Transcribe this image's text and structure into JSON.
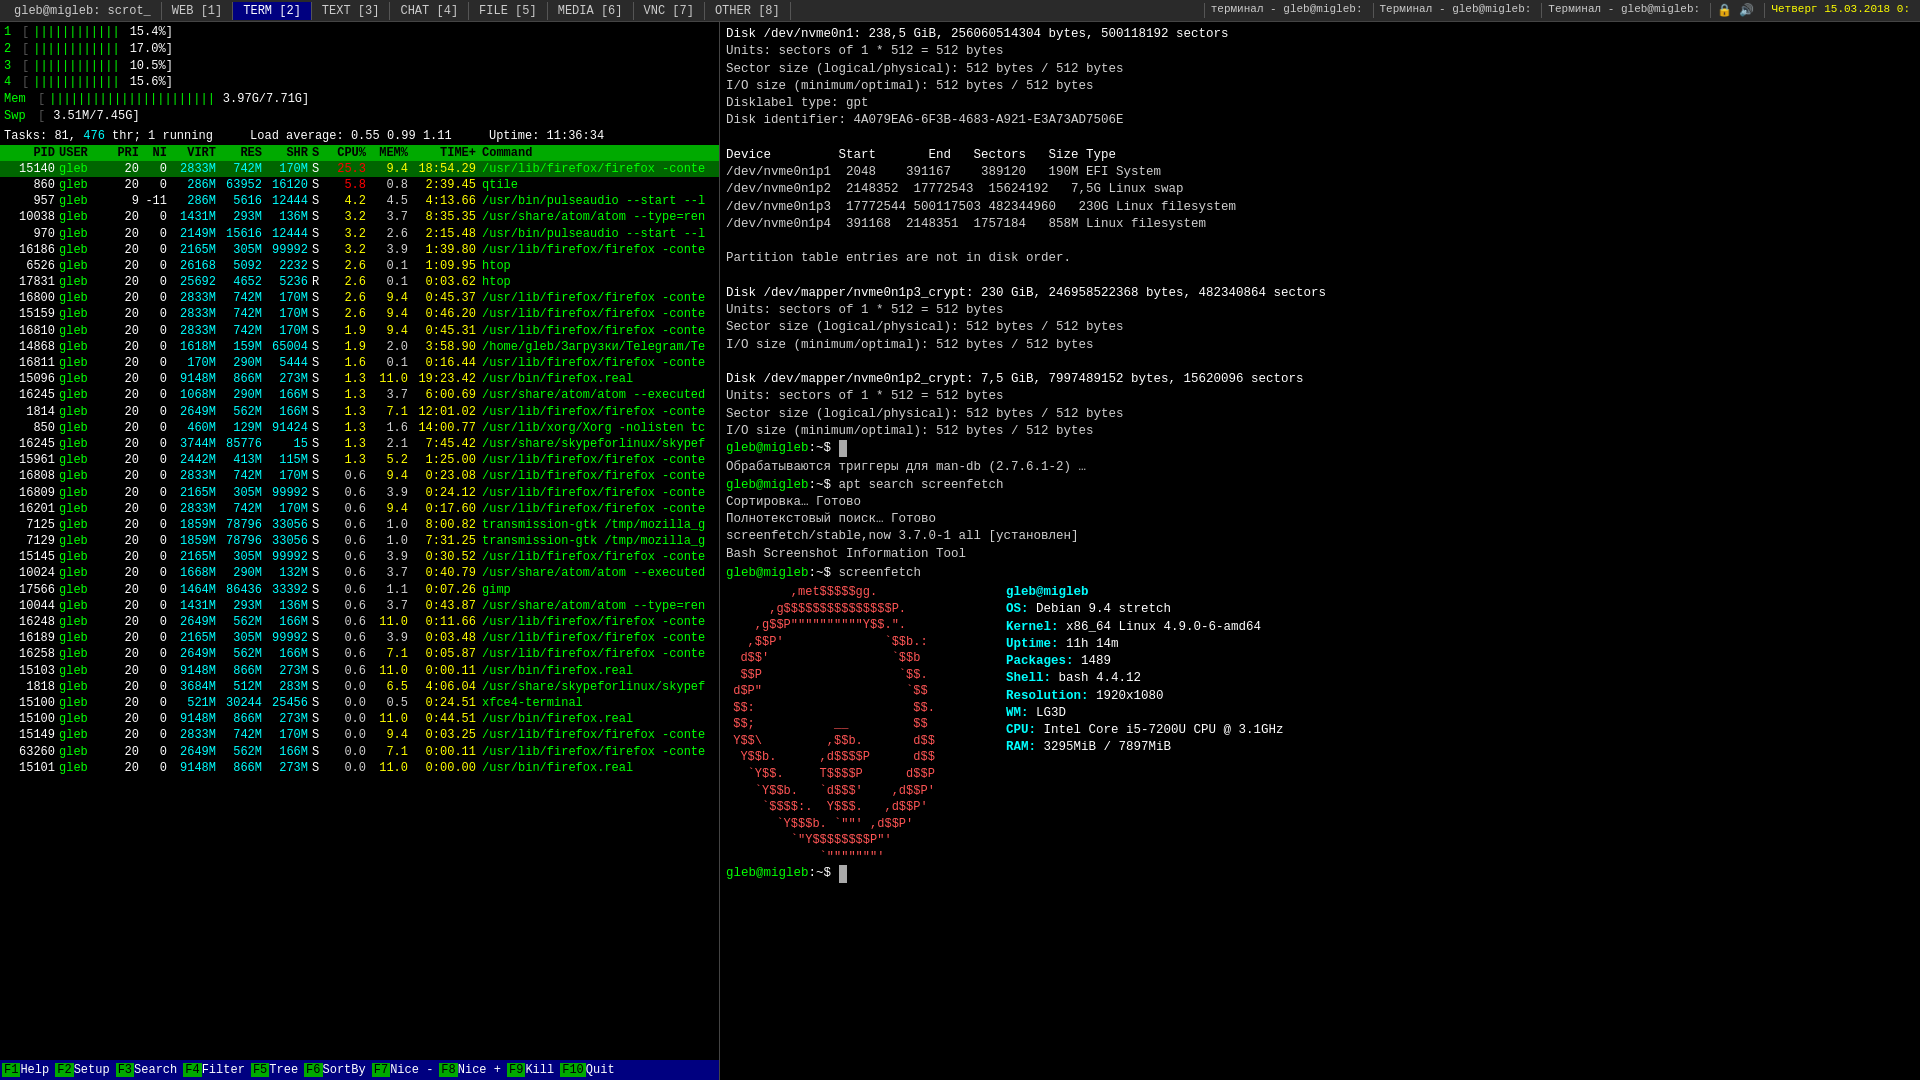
{
  "topbar": {
    "tabs": [
      {
        "label": "gleb@migleb: scrot_",
        "active": false,
        "type": "tab"
      },
      {
        "label": "WEB [1]",
        "active": false,
        "type": "tab"
      },
      {
        "label": "TERM [2]",
        "active": true,
        "type": "tab"
      },
      {
        "label": "TEXT [3]",
        "active": false,
        "type": "tab"
      },
      {
        "label": "CHAT [4]",
        "active": false,
        "type": "tab"
      },
      {
        "label": "FILE [5]",
        "active": false,
        "type": "tab"
      },
      {
        "label": "MEDIA [6]",
        "active": false,
        "type": "tab"
      },
      {
        "label": "VNC [7]",
        "active": false,
        "type": "tab"
      },
      {
        "label": "OTHER [8]",
        "active": false,
        "type": "tab"
      }
    ],
    "right_tabs": [
      {
        "label": "терминал - gleb@migleb:",
        "active": false
      },
      {
        "label": "Терминал - gleb@migleb:",
        "active": false
      },
      {
        "label": "Терминал - gleb@migleb:",
        "active": false
      }
    ],
    "datetime": "Четверг 15.03.2018 0:",
    "icon1": "🔒",
    "icon2": "🔊"
  },
  "htop": {
    "cpus": [
      {
        "num": "1",
        "bars": "||||||||||||",
        "pct": "15.4"
      },
      {
        "num": "2",
        "bars": "||||||||||||",
        "pct": "17.0"
      },
      {
        "num": "3",
        "bars": "||||||||||||",
        "pct": "10.5"
      },
      {
        "num": "4",
        "bars": "||||||||||||",
        "pct": "15.6"
      }
    ],
    "mem": {
      "bars": "||||||||||||||||||||||||",
      "used": "3.97G",
      "total": "7.71G"
    },
    "swp": {
      "bars": "",
      "used": "3.51M",
      "total": "7.45G"
    },
    "tasks_label": "Tasks:",
    "tasks_count": "81,",
    "tasks_thr": "476",
    "tasks_running": "1",
    "tasks_suffix": "thr; 1 running",
    "load_label": "Load average:",
    "load_vals": "0.55  0.99  1.11",
    "uptime_label": "Uptime:",
    "uptime_val": "11:36:34",
    "table_headers": [
      "PID",
      "USER",
      "PRI",
      "NI",
      "VIRT",
      "RES",
      "SHR",
      "S",
      "CPU%",
      "MEM%",
      "TIME+",
      "Command"
    ],
    "processes": [
      {
        "pid": "15140",
        "user": "gleb",
        "pri": "20",
        "ni": "0",
        "virt": "2833M",
        "res": "742M",
        "shr": "170M",
        "s": "S",
        "cpu": "25.3",
        "mem": "9.4",
        "time": "18:54.29",
        "cmd": "/usr/lib/firefox/firefox -conte",
        "highlight": true
      },
      {
        "pid": "860",
        "user": "gleb",
        "pri": "20",
        "ni": "0",
        "virt": "286M",
        "res": "63952",
        "shr": "16120",
        "s": "S",
        "cpu": "5.8",
        "mem": "0.8",
        "time": "2:39.45",
        "cmd": "qtile"
      },
      {
        "pid": "957",
        "user": "gleb",
        "pri": "9",
        "ni": "-11",
        "virt": "286M",
        "res": "5616",
        "shr": "12444",
        "s": "S",
        "cpu": "4.2",
        "mem": "4.5",
        "time": "4:13.66",
        "cmd": "/usr/bin/pulseaudio --start --l"
      },
      {
        "pid": "10038",
        "user": "gleb",
        "pri": "20",
        "ni": "0",
        "virt": "1431M",
        "res": "293M",
        "shr": "136M",
        "s": "S",
        "cpu": "3.2",
        "mem": "3.7",
        "time": "8:35.35",
        "cmd": "/usr/share/atom/atom --type=ren"
      },
      {
        "pid": "970",
        "user": "gleb",
        "pri": "20",
        "ni": "0",
        "virt": "2149M",
        "res": "15616",
        "shr": "12444",
        "s": "S",
        "cpu": "3.2",
        "mem": "2.6",
        "time": "2:15.48",
        "cmd": "/usr/bin/pulseaudio --start --l"
      },
      {
        "pid": "16186",
        "user": "gleb",
        "pri": "20",
        "ni": "0",
        "virt": "2165M",
        "res": "305M",
        "shr": "99992",
        "s": "S",
        "cpu": "3.2",
        "mem": "3.9",
        "time": "1:39.80",
        "cmd": "/usr/lib/firefox/firefox -conte"
      },
      {
        "pid": "6526",
        "user": "gleb",
        "pri": "20",
        "ni": "0",
        "virt": "26168",
        "res": "5092",
        "shr": "2232",
        "s": "S",
        "cpu": "2.6",
        "mem": "0.1",
        "time": "1:09.95",
        "cmd": "htop"
      },
      {
        "pid": "17831",
        "user": "gleb",
        "pri": "20",
        "ni": "0",
        "virt": "25692",
        "res": "4652",
        "shr": "5236",
        "s": "R",
        "cpu": "2.6",
        "mem": "0.1",
        "time": "0:03.62",
        "cmd": "htop"
      },
      {
        "pid": "16800",
        "user": "gleb",
        "pri": "20",
        "ni": "0",
        "virt": "2833M",
        "res": "742M",
        "shr": "170M",
        "s": "S",
        "cpu": "2.6",
        "mem": "9.4",
        "time": "0:45.37",
        "cmd": "/usr/lib/firefox/firefox -conte"
      },
      {
        "pid": "15159",
        "user": "gleb",
        "pri": "20",
        "ni": "0",
        "virt": "2833M",
        "res": "742M",
        "shr": "170M",
        "s": "S",
        "cpu": "2.6",
        "mem": "9.4",
        "time": "0:46.20",
        "cmd": "/usr/lib/firefox/firefox -conte"
      },
      {
        "pid": "16810",
        "user": "gleb",
        "pri": "20",
        "ni": "0",
        "virt": "2833M",
        "res": "742M",
        "shr": "170M",
        "s": "S",
        "cpu": "1.9",
        "mem": "9.4",
        "time": "0:45.31",
        "cmd": "/usr/lib/firefox/firefox -conte"
      },
      {
        "pid": "14868",
        "user": "gleb",
        "pri": "20",
        "ni": "0",
        "virt": "1618M",
        "res": "159M",
        "shr": "65004",
        "s": "S",
        "cpu": "1.9",
        "mem": "2.0",
        "time": "3:58.90",
        "cmd": "/home/gleb/Загрузки/Telegram/Te"
      },
      {
        "pid": "16811",
        "user": "gleb",
        "pri": "20",
        "ni": "0",
        "virt": "170M",
        "res": "290M",
        "shr": "5444",
        "s": "S",
        "cpu": "1.6",
        "mem": "0.1",
        "time": "0:16.44",
        "cmd": "/usr/lib/firefox/firefox -conte"
      },
      {
        "pid": "15096",
        "user": "gleb",
        "pri": "20",
        "ni": "0",
        "virt": "9148M",
        "res": "866M",
        "shr": "273M",
        "s": "S",
        "cpu": "1.3",
        "mem": "11.0",
        "time": "19:23.42",
        "cmd": "/usr/bin/firefox.real"
      },
      {
        "pid": "16245",
        "user": "gleb",
        "pri": "20",
        "ni": "0",
        "virt": "1068M",
        "res": "290M",
        "shr": "166M",
        "s": "S",
        "cpu": "1.3",
        "mem": "3.7",
        "time": "6:00.69",
        "cmd": "/usr/share/atom/atom --executed"
      },
      {
        "pid": "1814",
        "user": "gleb",
        "pri": "20",
        "ni": "0",
        "virt": "2649M",
        "res": "562M",
        "shr": "166M",
        "s": "S",
        "cpu": "1.3",
        "mem": "7.1",
        "time": "12:01.02",
        "cmd": "/usr/lib/firefox/firefox -conte"
      },
      {
        "pid": "850",
        "user": "gleb",
        "pri": "20",
        "ni": "0",
        "virt": "460M",
        "res": "129M",
        "shr": "91424",
        "s": "S",
        "cpu": "1.3",
        "mem": "1.6",
        "time": "14:00.77",
        "cmd": "/usr/lib/xorg/Xorg -nolisten tc"
      },
      {
        "pid": "16245",
        "user": "gleb",
        "pri": "20",
        "ni": "0",
        "virt": "3744M",
        "res": "85776",
        "shr": "15",
        "s": "S",
        "cpu": "1.3",
        "mem": "2.1",
        "time": "7:45.42",
        "cmd": "/usr/share/skypeforlinux/skypef"
      },
      {
        "pid": "15961",
        "user": "gleb",
        "pri": "20",
        "ni": "0",
        "virt": "2442M",
        "res": "413M",
        "shr": "115M",
        "s": "S",
        "cpu": "1.3",
        "mem": "5.2",
        "time": "1:25.00",
        "cmd": "/usr/lib/firefox/firefox -conte"
      },
      {
        "pid": "16808",
        "user": "gleb",
        "pri": "20",
        "ni": "0",
        "virt": "2833M",
        "res": "742M",
        "shr": "170M",
        "s": "S",
        "cpu": "0.6",
        "mem": "9.4",
        "time": "0:23.08",
        "cmd": "/usr/lib/firefox/firefox -conte"
      },
      {
        "pid": "16809",
        "user": "gleb",
        "pri": "20",
        "ni": "0",
        "virt": "2165M",
        "res": "305M",
        "shr": "99992",
        "s": "S",
        "cpu": "0.6",
        "mem": "3.9",
        "time": "0:24.12",
        "cmd": "/usr/lib/firefox/firefox -conte"
      },
      {
        "pid": "16201",
        "user": "gleb",
        "pri": "20",
        "ni": "0",
        "virt": "2833M",
        "res": "742M",
        "shr": "170M",
        "s": "S",
        "cpu": "0.6",
        "mem": "9.4",
        "time": "0:17.60",
        "cmd": "/usr/lib/firefox/firefox -conte"
      },
      {
        "pid": "7125",
        "user": "gleb",
        "pri": "20",
        "ni": "0",
        "virt": "1859M",
        "res": "78796",
        "shr": "33056",
        "s": "S",
        "cpu": "0.6",
        "mem": "1.0",
        "time": "8:00.82",
        "cmd": "transmission-gtk /tmp/mozilla_g"
      },
      {
        "pid": "7129",
        "user": "gleb",
        "pri": "20",
        "ni": "0",
        "virt": "1859M",
        "res": "78796",
        "shr": "33056",
        "s": "S",
        "cpu": "0.6",
        "mem": "1.0",
        "time": "7:31.25",
        "cmd": "transmission-gtk /tmp/mozilla_g"
      },
      {
        "pid": "15145",
        "user": "gleb",
        "pri": "20",
        "ni": "0",
        "virt": "2165M",
        "res": "305M",
        "shr": "99992",
        "s": "S",
        "cpu": "0.6",
        "mem": "3.9",
        "time": "0:30.52",
        "cmd": "/usr/lib/firefox/firefox -conte"
      },
      {
        "pid": "10024",
        "user": "gleb",
        "pri": "20",
        "ni": "0",
        "virt": "1668M",
        "res": "290M",
        "shr": "132M",
        "s": "S",
        "cpu": "0.6",
        "mem": "3.7",
        "time": "0:40.79",
        "cmd": "/usr/share/atom/atom --executed"
      },
      {
        "pid": "17566",
        "user": "gleb",
        "pri": "20",
        "ni": "0",
        "virt": "1464M",
        "res": "86436",
        "shr": "33392",
        "s": "S",
        "cpu": "0.6",
        "mem": "1.1",
        "time": "0:07.26",
        "cmd": "gimp"
      },
      {
        "pid": "10044",
        "user": "gleb",
        "pri": "20",
        "ni": "0",
        "virt": "1431M",
        "res": "293M",
        "shr": "136M",
        "s": "S",
        "cpu": "0.6",
        "mem": "3.7",
        "time": "0:43.87",
        "cmd": "/usr/share/atom/atom --type=ren"
      },
      {
        "pid": "16248",
        "user": "gleb",
        "pri": "20",
        "ni": "0",
        "virt": "2649M",
        "res": "562M",
        "shr": "166M",
        "s": "S",
        "cpu": "0.6",
        "mem": "11.0",
        "time": "0:11.66",
        "cmd": "/usr/lib/firefox/firefox -conte"
      },
      {
        "pid": "16189",
        "user": "gleb",
        "pri": "20",
        "ni": "0",
        "virt": "2165M",
        "res": "305M",
        "shr": "99992",
        "s": "S",
        "cpu": "0.6",
        "mem": "3.9",
        "time": "0:03.48",
        "cmd": "/usr/lib/firefox/firefox -conte"
      },
      {
        "pid": "16258",
        "user": "gleb",
        "pri": "20",
        "ni": "0",
        "virt": "2649M",
        "res": "562M",
        "shr": "166M",
        "s": "S",
        "cpu": "0.6",
        "mem": "7.1",
        "time": "0:05.87",
        "cmd": "/usr/lib/firefox/firefox -conte"
      },
      {
        "pid": "15103",
        "user": "gleb",
        "pri": "20",
        "ni": "0",
        "virt": "9148M",
        "res": "866M",
        "shr": "273M",
        "s": "S",
        "cpu": "0.6",
        "mem": "11.0",
        "time": "0:00.11",
        "cmd": "/usr/bin/firefox.real"
      },
      {
        "pid": "1818",
        "user": "gleb",
        "pri": "20",
        "ni": "0",
        "virt": "3684M",
        "res": "512M",
        "shr": "283M",
        "s": "S",
        "cpu": "0.0",
        "mem": "6.5",
        "time": "4:06.04",
        "cmd": "/usr/share/skypeforlinux/skypef"
      },
      {
        "pid": "15100",
        "user": "gleb",
        "pri": "20",
        "ni": "0",
        "virt": "521M",
        "res": "30244",
        "shr": "25456",
        "s": "S",
        "cpu": "0.0",
        "mem": "0.5",
        "time": "0:24.51",
        "cmd": "xfce4-terminal"
      },
      {
        "pid": "15100",
        "user": "gleb",
        "pri": "20",
        "ni": "0",
        "virt": "9148M",
        "res": "866M",
        "shr": "273M",
        "s": "S",
        "cpu": "0.0",
        "mem": "11.0",
        "time": "0:44.51",
        "cmd": "/usr/bin/firefox.real"
      },
      {
        "pid": "15149",
        "user": "gleb",
        "pri": "20",
        "ni": "0",
        "virt": "2833M",
        "res": "742M",
        "shr": "170M",
        "s": "S",
        "cpu": "0.0",
        "mem": "9.4",
        "time": "0:03.25",
        "cmd": "/usr/lib/firefox/firefox -conte"
      },
      {
        "pid": "63260",
        "user": "gleb",
        "pri": "20",
        "ni": "0",
        "virt": "2649M",
        "res": "562M",
        "shr": "166M",
        "s": "S",
        "cpu": "0.0",
        "mem": "7.1",
        "time": "0:00.11",
        "cmd": "/usr/lib/firefox/firefox -conte"
      },
      {
        "pid": "15101",
        "user": "gleb",
        "pri": "20",
        "ni": "0",
        "virt": "9148M",
        "res": "866M",
        "shr": "273M",
        "s": "S",
        "cpu": "0.0",
        "mem": "11.0",
        "time": "0:00.00",
        "cmd": "/usr/bin/firefox.real"
      }
    ],
    "bottom_keys": [
      {
        "key": "F1",
        "label": "Help"
      },
      {
        "key": "F2",
        "label": "Setup"
      },
      {
        "key": "F3",
        "label": "Search"
      },
      {
        "key": "F4",
        "label": "Filter"
      },
      {
        "key": "F5",
        "label": "Tree"
      },
      {
        "key": "F6",
        "label": "SortBy"
      },
      {
        "key": "F7",
        "label": "Nice -"
      },
      {
        "key": "F8",
        "label": "Nice +"
      },
      {
        "key": "F9",
        "label": "Kill"
      },
      {
        "key": "F10",
        "label": "Quit"
      }
    ]
  },
  "right_terminal": {
    "tab_label": "gleb@migleb: ~$",
    "disk_output": [
      "Disk /dev/nvme0n1: 238,5 GiB, 256060514304 bytes, 500118192 sectors",
      "Units: sectors of 1 * 512 = 512 bytes",
      "Sector size (logical/physical): 512 bytes / 512 bytes",
      "I/O size (minimum/optimal): 512 bytes / 512 bytes",
      "Disklabel type: gpt",
      "Disk identifier: 4A079EA6-6F3B-4683-A921-E3A73AD7506E",
      "",
      "Device         Start       End   Sectors   Size Type",
      "/dev/nvme0n1p1  2048    391167    389120   190M EFI System",
      "/dev/nvme0n1p2  2148352  17772543  15624192   7,5G Linux swap",
      "/dev/nvme0n1p3  17772544 500117503 482344960   230G Linux filesystem",
      "/dev/nvme0n1p4  391168  2148351  1757184   858M Linux filesystem",
      "",
      "Partition table entries are not in disk order.",
      "",
      "Disk /dev/mapper/nvme0n1p3_crypt: 230 GiB, 246958522368 bytes, 482340864 sectors",
      "Units: sectors of 1 * 512 = 512 bytes",
      "Sector size (logical/physical): 512 bytes / 512 bytes",
      "I/O size (minimum/optimal): 512 bytes / 512 bytes",
      "",
      "Disk /dev/mapper/nvme0n1p2_crypt: 7,5 GiB, 7997489152 bytes, 15620096 sectors",
      "Units: sectors of 1 * 512 = 512 bytes",
      "Sector size (logical/physical): 512 bytes / 512 bytes",
      "I/O size (minimum/optimal): 512 bytes / 512 bytes"
    ],
    "prompt1": "gleb@migleb:~$",
    "blank_cmd": "",
    "apt_output": [
      "Обрабатываются триггеры для man-db (2.7.6.1-2) …",
      "gleb@migleb:~$ apt search screenfetch",
      "Сортировка… Готово",
      "Полнотекстовый поиск… Готово",
      "screenfetch/stable,now 3.7.0-1 all [установлен]",
      "Bash Screenshot Information Tool"
    ],
    "screenfetch_cmd": "gleb@migleb:~$ screenfetch",
    "ascii_art": [
      "         ,met$$$$$gg.",
      "      ,g$$$$$$$$$$$$$$$P.",
      "    ,g$$P\"\"\"\"\"\"\"\"\"\"Y$$.\".  ",
      "   ,$$P'              `$$b.:  ",
      "  d$$'                 `$$b",
      "  $$P                   `$$.",
      " d$P\"                    `$$",
      " $$:                      $$.",
      " $$;           __         $$",
      " Y$$\\         ,$$b.       d$$",
      "  Y$$b.      ,d$$$$P      d$$",
      "   `Y$$.     T$$$$P      d$$P",
      "    `Y$$b.   `d$$$'    ,d$$P'",
      "     `$$$$:.  Y$$$.   ,d$$P'",
      "       `Y$$$b. `\"\"' ,d$$P'",
      "         `\"Y$$$$$$$$P\"'",
      "             `\"\"\"\"\"\"\"'"
    ],
    "sysinfo": {
      "hostname": "gleb@migleb",
      "os_label": "OS:",
      "os_val": "Debian 9.4 stretch",
      "kernel_label": "Kernel:",
      "kernel_val": "x86_64 Linux 4.9.0-6-amd64",
      "uptime_label": "Uptime:",
      "uptime_val": "11h 14m",
      "packages_label": "Packages:",
      "packages_val": "1489",
      "shell_label": "Shell:",
      "shell_val": "bash 4.4.12",
      "resolution_label": "Resolution:",
      "resolution_val": "1920x1080",
      "wm_label": "WM:",
      "wm_val": "LG3D",
      "cpu_label": "CPU:",
      "cpu_val": "Intel Core i5-7200U CPU @ 3.1GHz",
      "ram_label": "RAM:",
      "ram_val": "3295MiB / 7897MiB"
    },
    "final_prompt": "gleb@migleb:~$"
  }
}
